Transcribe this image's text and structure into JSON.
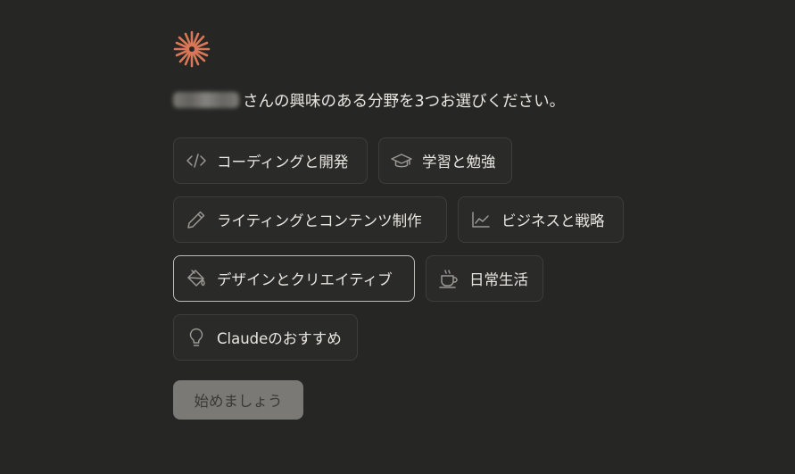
{
  "prompt": {
    "name_redacted": true,
    "text": "さんの興味のある分野を3つお選びください。"
  },
  "options": [
    {
      "label": "コーディングと開発",
      "icon": "code-icon",
      "selected": false
    },
    {
      "label": "学習と勉強",
      "icon": "graduation-cap-icon",
      "selected": false
    },
    {
      "label": "ライティングとコンテンツ制作",
      "icon": "pencil-icon",
      "selected": false
    },
    {
      "label": "ビジネスと戦略",
      "icon": "line-chart-icon",
      "selected": false
    },
    {
      "label": "デザインとクリエイティブ",
      "icon": "paint-bucket-icon",
      "selected": true
    },
    {
      "label": "日常生活",
      "icon": "coffee-cup-icon",
      "selected": false
    },
    {
      "label": "Claudeのおすすめ",
      "icon": "lightbulb-icon",
      "selected": false
    }
  ],
  "start_button": {
    "label": "始めましょう",
    "enabled": false
  },
  "colors": {
    "background": "#262624",
    "accent": "#d97757",
    "option_border": "#3e3d39",
    "option_selected_border": "#bdbbb5",
    "button_disabled": "#7a7975"
  }
}
